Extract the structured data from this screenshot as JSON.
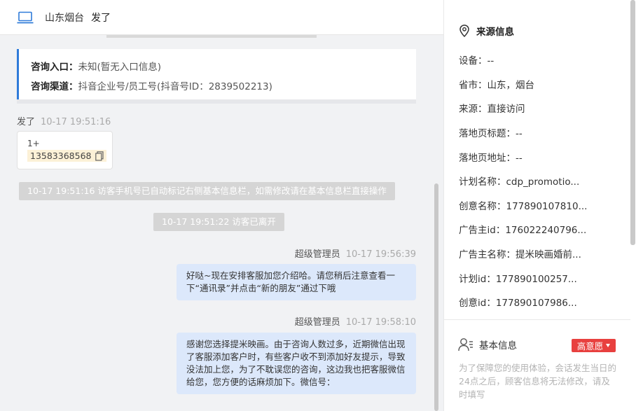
{
  "header": {
    "location": "山东烟台",
    "visitor_name": "发了"
  },
  "entry_card": {
    "entry_label": "咨询入口：",
    "entry_value": "未知(暂无入口信息)",
    "channel_label": "咨询渠道：",
    "channel_value": "抖音企业号/员工号(抖音号ID：2839502213)"
  },
  "messages": {
    "visitor_sender": "发了",
    "visitor_time": "10-17 19:51:16",
    "phone_prefix": "1+",
    "phone_number": "13583368568",
    "sys_note_1": "10-17 19:51:16 访客手机号已自动标记右侧基本信息栏，如需修改请在基本信息栏直接操作",
    "sys_note_2": "10-17 19:51:22 访客已离开",
    "agent_sender": "超级管理员",
    "agent_time_1": "10-17 19:56:39",
    "agent_msg_1": "好哒~现在安排客服加您介绍哈。请您稍后注意查看一下“通讯录”并点击“新的朋友”通过下哦",
    "agent_time_2": "10-17 19:58:10",
    "agent_msg_2": "感谢您选择提米映画。由于咨询人数过多，近期微信出现了客服添加客户时，有些客户收不到添加好友提示，导致没法加上您，为了不耽误您的咨询，这边我也把客服微信给您，您方便的话麻烦加下。微信号："
  },
  "source_info": {
    "title": "来源信息",
    "rows": [
      "设备：--",
      "省市：山东，烟台",
      "来源：直接访问",
      "落地页标题：--",
      "落地页地址：--",
      "计划名称：cdp_promotio...",
      "创意名称：177890107810...",
      "广告主id：176022240796...",
      "广告主名称：提米映画婚前...",
      "计划id：177890100257...",
      "创意id：177890107986..."
    ]
  },
  "basic_info": {
    "title": "基本信息",
    "intent_label": "高意愿",
    "note": "为了保障您的使用体验，会话发生当日的24点之后，顾客信息将无法修改，请及时填写"
  },
  "colors": {
    "accent_blue": "#2f7bd9",
    "agent_bubble": "#dce8fb",
    "badge_red": "#e8403f",
    "phone_highlight": "#fcf1d7"
  }
}
